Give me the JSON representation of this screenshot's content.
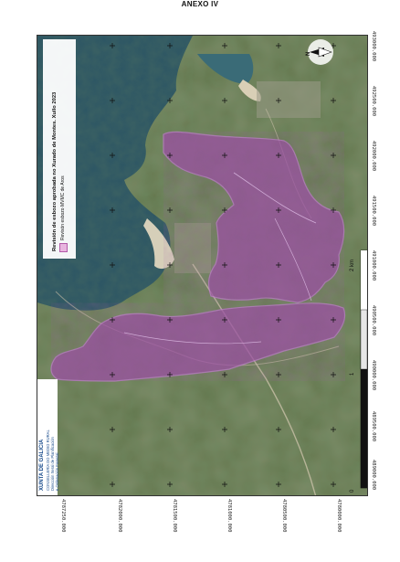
{
  "annex_title": "ANEXO IV",
  "map": {
    "title": "Revisión de esbozo aprobada no Xurado de Montes. Xullo 2023",
    "legend_label": "Revisón esbozo MVMC de Aros",
    "polygon_fill": "#9b4fa3",
    "polygon_stroke": "#c27fd0",
    "north_arrow_label": "N"
  },
  "scale": {
    "labels": [
      "0",
      "1",
      "2 km"
    ]
  },
  "coordinates": {
    "right_axis": [
      "493000.000",
      "492500.000",
      "492000.000",
      "491500.000",
      "491000.000",
      "490500.000",
      "490000.000",
      "489500.000",
      "489000.000"
    ],
    "bottom_axis": [
      "4787250.000",
      "4782000.000",
      "4781500.000",
      "4781000.000",
      "4780500.000",
      "4780000.000"
    ]
  },
  "logo": {
    "org": "XUNTA DE GALICIA",
    "line1": "CONSELLERÍA DO MEDIO RURAL",
    "line2": "Dirección Xeral de Planificación",
    "line3": "e Ordenación Forestal"
  }
}
